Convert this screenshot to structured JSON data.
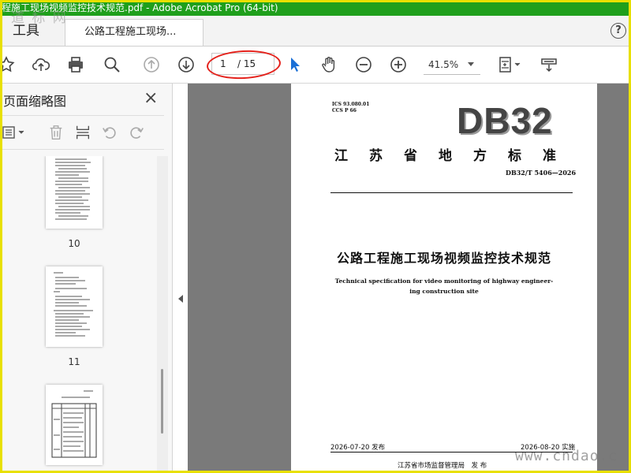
{
  "window": {
    "title": "程施工现场视频监控技术规范.pdf - Adobe Acrobat Pro (64-bit)"
  },
  "watermarks": {
    "top": "道 标 网",
    "bottom": "www.cndao.c"
  },
  "tabs": {
    "tools": "工具",
    "document": "公路工程施工现场..."
  },
  "help": {
    "label": "?"
  },
  "toolbar": {
    "page_current": "1",
    "page_total": "/ 15",
    "zoom": "41.5%",
    "icons": [
      "star-icon",
      "upload-icon",
      "print-icon",
      "search-icon",
      "page-up-icon",
      "page-down-icon",
      "select-cursor-icon",
      "hand-icon",
      "zoom-out-icon",
      "zoom-in-icon",
      "fit-page-icon",
      "read-mode-icon"
    ]
  },
  "sidebar": {
    "title": "页面缩略图",
    "close": "×",
    "thumbnails": [
      {
        "label": "10"
      },
      {
        "label": "11"
      },
      {
        "label": ""
      }
    ]
  },
  "document": {
    "ics": "ICS 93.080.01",
    "ccs": "CCS P 66",
    "logo": "DB32",
    "std_name": "江苏省地方标准",
    "std_number": "DB32/T 5406—2026",
    "title_zh": "公路工程施工现场视频监控技术规范",
    "title_en_1": "Technical specification for video monitoring of highway engineer-",
    "title_en_2": "ing construction site",
    "issue_date": "2026-07-20 发布",
    "impl_date": "2026-08-20 实施",
    "issuer": "江苏省市场监督管理局　发 布"
  },
  "colors": {
    "titlebar": "#1f9f1c",
    "frame": "#e8e000",
    "annotation": "#e4211b",
    "cursor": "#1a6fd6"
  }
}
